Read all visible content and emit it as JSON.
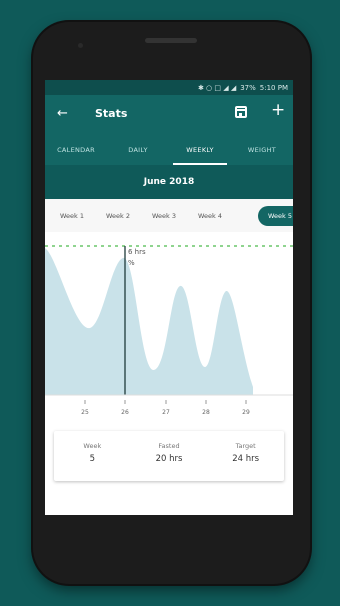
{
  "status": {
    "icons_text": "✱ ○ □ ◢ ◢",
    "battery": "37%",
    "time": "5:10 PM"
  },
  "appbar": {
    "title": "Stats",
    "back_icon": "←",
    "add_icon": "+"
  },
  "tabs": [
    "CALENDAR",
    "DAILY",
    "WEEKLY",
    "WEIGHT"
  ],
  "active_tab": 2,
  "month": "June 2018",
  "weeks": [
    "Week 1",
    "Week 2",
    "Week 3",
    "Week 4",
    "Week 5"
  ],
  "active_week": 4,
  "chart_data": {
    "type": "area",
    "x_labels": [
      "25",
      "26",
      "27",
      "28",
      "29"
    ],
    "target_line_label": "",
    "cursor_label_value": "6 hrs",
    "cursor_label_pct": "%",
    "color_fill": "#c9e2e9",
    "color_target": "#8fd48f"
  },
  "summary": [
    {
      "label": "Week",
      "value": "5"
    },
    {
      "label": "Fasted",
      "value": "20 hrs"
    },
    {
      "label": "Target",
      "value": "24 hrs"
    }
  ]
}
